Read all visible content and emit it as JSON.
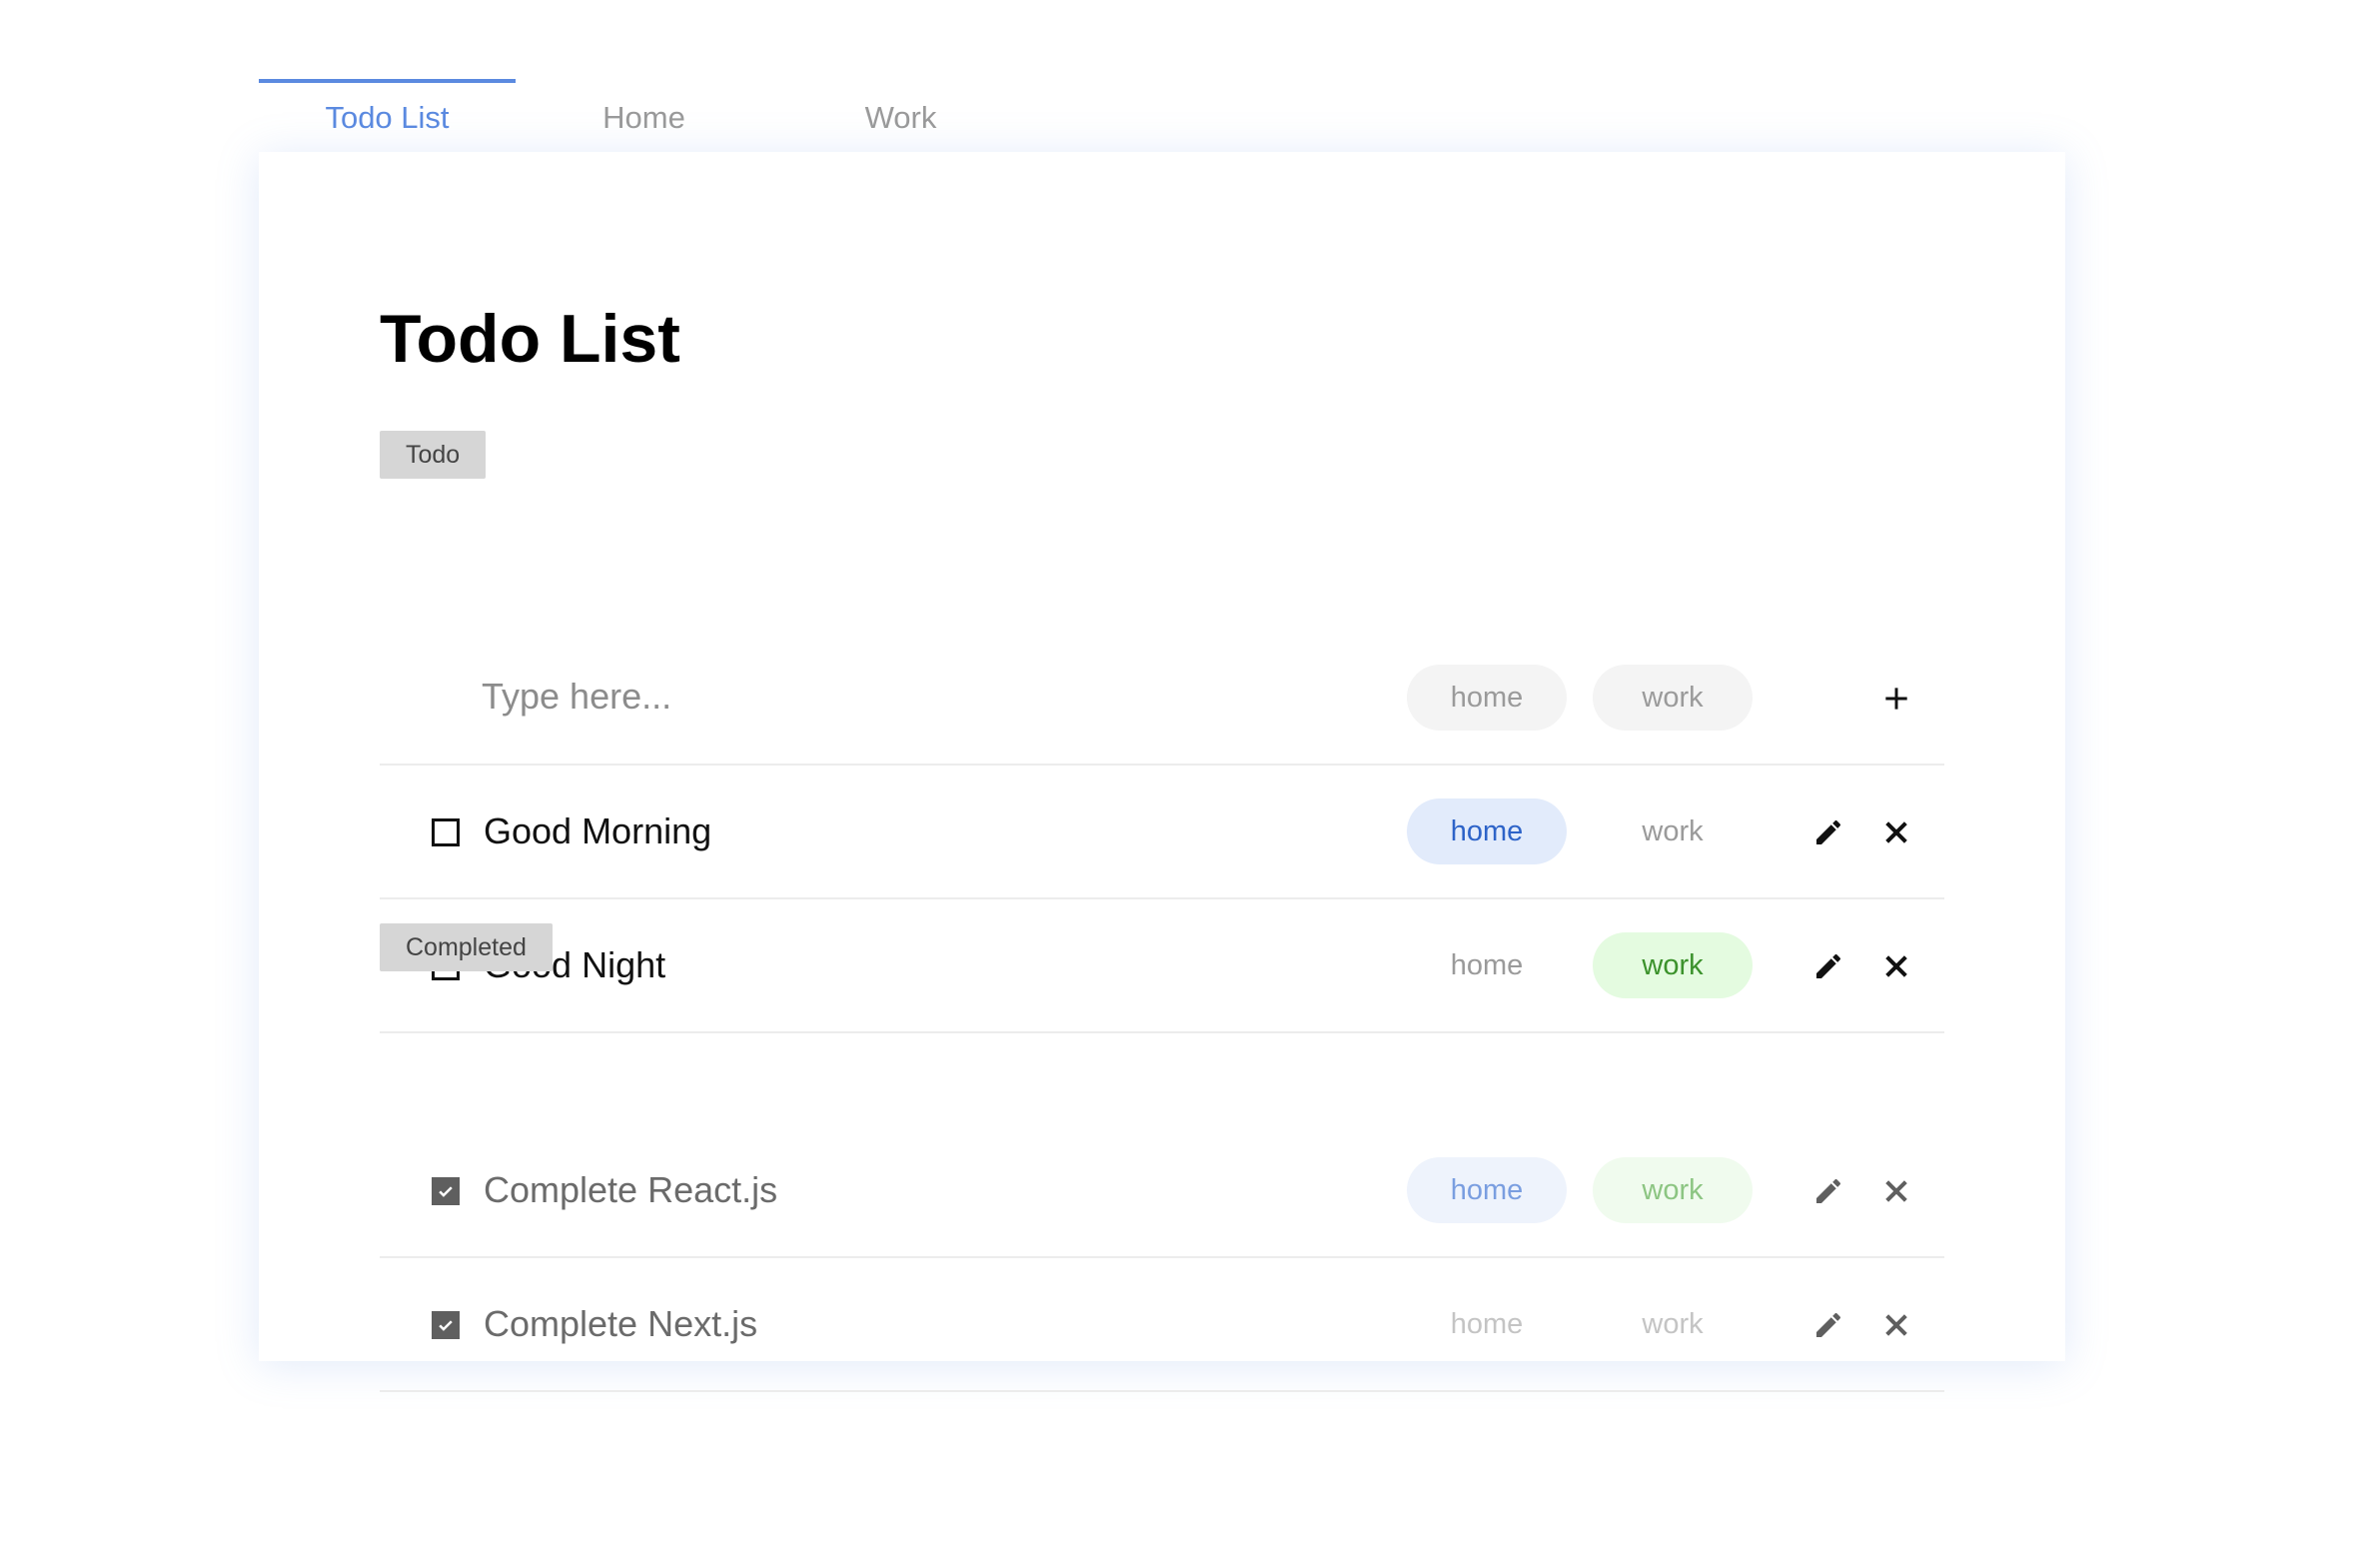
{
  "tabs": [
    {
      "label": "Todo List"
    },
    {
      "label": "Home"
    },
    {
      "label": "Work"
    }
  ],
  "active_tab": "Todo List",
  "page_title": "Todo List",
  "sections": {
    "todo_label": "Todo",
    "completed_label": "Completed"
  },
  "new_todo": {
    "placeholder": "Type here...",
    "value": "",
    "tags": {
      "home": "home",
      "work": "work"
    }
  },
  "todos": [
    {
      "text": "Good Morning",
      "done": false,
      "home_label": "home",
      "work_label": "work",
      "home": true,
      "work": false
    },
    {
      "text": "Good Night",
      "done": false,
      "home_label": "home",
      "work_label": "work",
      "home": false,
      "work": true
    }
  ],
  "completed": [
    {
      "text": "Complete React.js",
      "done": true,
      "home_label": "home",
      "work_label": "work",
      "home": true,
      "work": true
    },
    {
      "text": "Complete Next.js",
      "done": true,
      "home_label": "home",
      "work_label": "work",
      "home": false,
      "work": false
    }
  ],
  "icons": {
    "add": "plus-icon",
    "edit": "pencil-icon",
    "delete": "close-icon",
    "checked": "checkmark-icon"
  },
  "colors": {
    "accent": "#5b8ae0",
    "home_tag_bg": "#e2ebfb",
    "home_tag_text": "#2d63c8",
    "work_tag_bg": "#e4fbe0",
    "work_tag_text": "#3b922b",
    "section_label_bg": "#d6d6d6"
  }
}
